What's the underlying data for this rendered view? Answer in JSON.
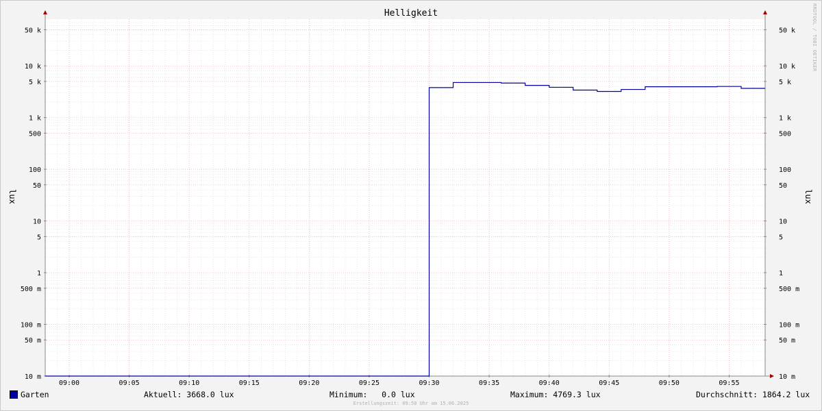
{
  "chart_data": {
    "type": "line",
    "title": "Helligkeit",
    "ylabel_left": "lux",
    "ylabel_right": "lux",
    "yscale": "log",
    "ylim": [
      10,
      80000
    ],
    "xlim": [
      "08:58",
      "09:58"
    ],
    "x_ticks": [
      "09:00",
      "09:05",
      "09:10",
      "09:15",
      "09:20",
      "09:25",
      "09:30",
      "09:35",
      "09:40",
      "09:45",
      "09:50",
      "09:55"
    ],
    "y_ticks": [
      {
        "value": 50000,
        "label": "50 k"
      },
      {
        "value": 10000,
        "label": "10 k"
      },
      {
        "value": 5000,
        "label": "5 k"
      },
      {
        "value": 1000,
        "label": "1 k"
      },
      {
        "value": 500,
        "label": "500"
      },
      {
        "value": 100,
        "label": "100"
      },
      {
        "value": 50,
        "label": "50"
      },
      {
        "value": 10,
        "label": "10"
      },
      {
        "value": 5,
        "label": "5"
      },
      {
        "value": 1,
        "label": "1"
      },
      {
        "value": 0.5,
        "label": "500 m"
      },
      {
        "value": 0.1,
        "label": "100 m"
      },
      {
        "value": 0.05,
        "label": "50 m"
      },
      {
        "value": 0.01,
        "label": "10 m"
      }
    ],
    "series": [
      {
        "name": "Garten",
        "color": "#0000a0",
        "points": [
          {
            "x": "08:58",
            "y": 0.01
          },
          {
            "x": "09:30",
            "y": 0.01
          },
          {
            "x": "09:30",
            "y": 3800
          },
          {
            "x": "09:32",
            "y": 3800
          },
          {
            "x": "09:32",
            "y": 4769.3
          },
          {
            "x": "09:36",
            "y": 4769.3
          },
          {
            "x": "09:36",
            "y": 4650
          },
          {
            "x": "09:38",
            "y": 4650
          },
          {
            "x": "09:38",
            "y": 4200
          },
          {
            "x": "09:40",
            "y": 4200
          },
          {
            "x": "09:40",
            "y": 3850
          },
          {
            "x": "09:42",
            "y": 3850
          },
          {
            "x": "09:42",
            "y": 3400
          },
          {
            "x": "09:44",
            "y": 3400
          },
          {
            "x": "09:44",
            "y": 3200
          },
          {
            "x": "09:46",
            "y": 3200
          },
          {
            "x": "09:46",
            "y": 3500
          },
          {
            "x": "09:48",
            "y": 3500
          },
          {
            "x": "09:48",
            "y": 3950
          },
          {
            "x": "09:54",
            "y": 3950
          },
          {
            "x": "09:54",
            "y": 4000
          },
          {
            "x": "09:56",
            "y": 4000
          },
          {
            "x": "09:56",
            "y": 3668.0
          },
          {
            "x": "09:58",
            "y": 3668.0
          }
        ]
      }
    ],
    "grid": true,
    "legend_position": "bottom"
  },
  "legend": {
    "series_name": "Garten",
    "current": "Aktuell: 3668.0 lux",
    "minimum": "Minimum:   0.0 lux",
    "maximum": "Maximum: 4769.3 lux",
    "average": "Durchschnitt: 1864.2 lux"
  },
  "footer": "Erstellungszeit: 09:58 Uhr am 15.06.2025",
  "watermark": "RRDTOOL / TOBI OETIKER"
}
